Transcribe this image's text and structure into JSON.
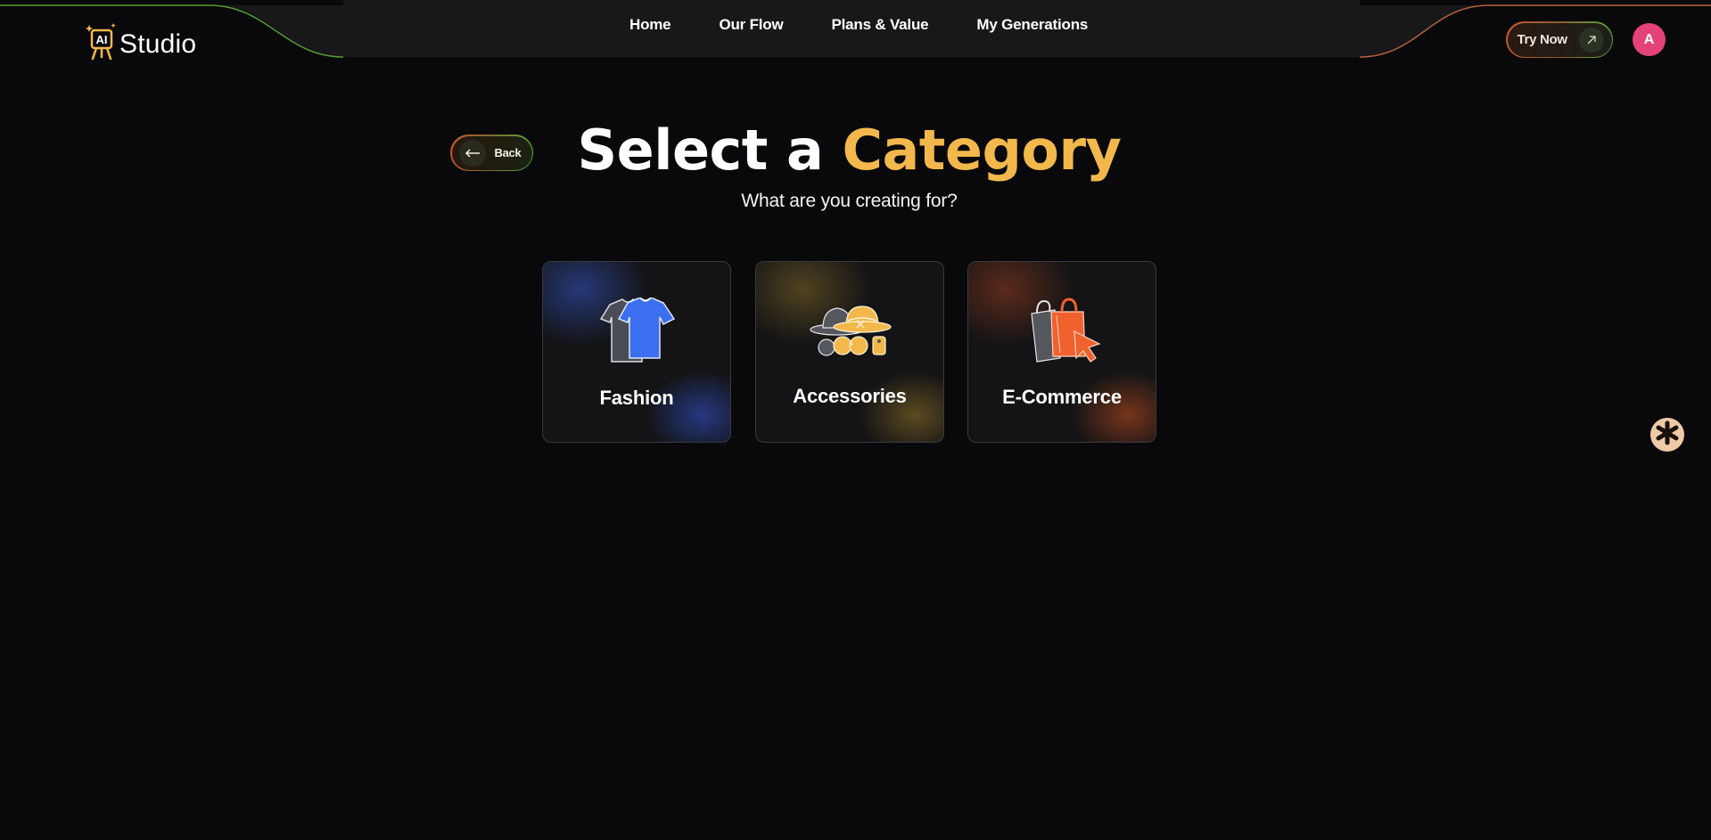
{
  "header": {
    "brand": {
      "badge": "AI",
      "name": "Studio"
    },
    "nav": [
      {
        "label": "Home"
      },
      {
        "label": "Our Flow"
      },
      {
        "label": "Plans & Value"
      },
      {
        "label": "My Generations"
      }
    ],
    "cta": {
      "label": "Try Now",
      "icon": "arrow-up-right-icon"
    },
    "avatar": {
      "initial": "A",
      "color": "#e5427a"
    }
  },
  "back": {
    "label": "Back",
    "icon": "arrow-left-icon"
  },
  "title": {
    "part1": "Select a",
    "part2": "Category"
  },
  "subtitle": "What are you creating for?",
  "categories": [
    {
      "label": "Fashion",
      "icon": "tshirt-icon",
      "accent": "#3b66e6"
    },
    {
      "label": "Accessories",
      "icon": "hat-sunglasses-icon",
      "accent": "#f2b84b"
    },
    {
      "label": "E-Commerce",
      "icon": "shopping-bag-icon",
      "accent": "#f0612e"
    }
  ],
  "floating_button": {
    "icon": "asterisk-icon"
  },
  "colors": {
    "background": "#09090b",
    "accent_yellow": "#f2b84b",
    "accent_orange": "#f0612e",
    "accent_green": "#5aa83a",
    "accent_blue": "#3b66e6"
  }
}
